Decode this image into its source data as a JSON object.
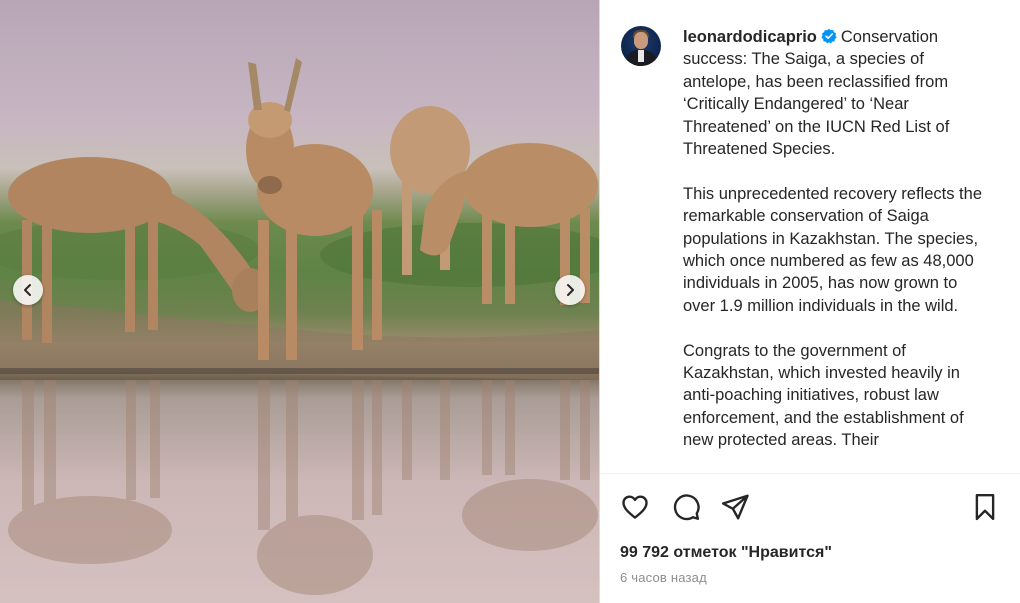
{
  "post": {
    "username": "leonardodicaprio",
    "caption_paragraphs": [
      "Conservation success: The Saiga, a species of antelope, has been reclassified from ‘Critically Endangered’ to ‘Near Threatened’ on the IUCN Red List of Threatened Species.",
      "This unprecedented recovery reflects the remarkable conservation of Saiga populations in Kazakhstan. The species, which once numbered as few as 48,000 individuals in 2005, has now grown to over 1.9 million individuals in the wild.",
      "Congrats to the government of Kazakhstan, which invested heavily in anti-poaching initiatives, robust law enforcement, and the establishment of new protected areas. Their"
    ],
    "likes_text": "99 792 отметок \"Нравится\"",
    "time_text": "6 часов назад"
  },
  "icons": {
    "verified": "verified-badge-icon",
    "like": "heart-icon",
    "comment": "comment-icon",
    "share": "paper-plane-icon",
    "save": "bookmark-icon",
    "prev": "chevron-left-icon",
    "next": "chevron-right-icon"
  },
  "colors": {
    "verified_blue": "#0095f6",
    "text": "#262626",
    "muted": "#8e8e8e"
  }
}
